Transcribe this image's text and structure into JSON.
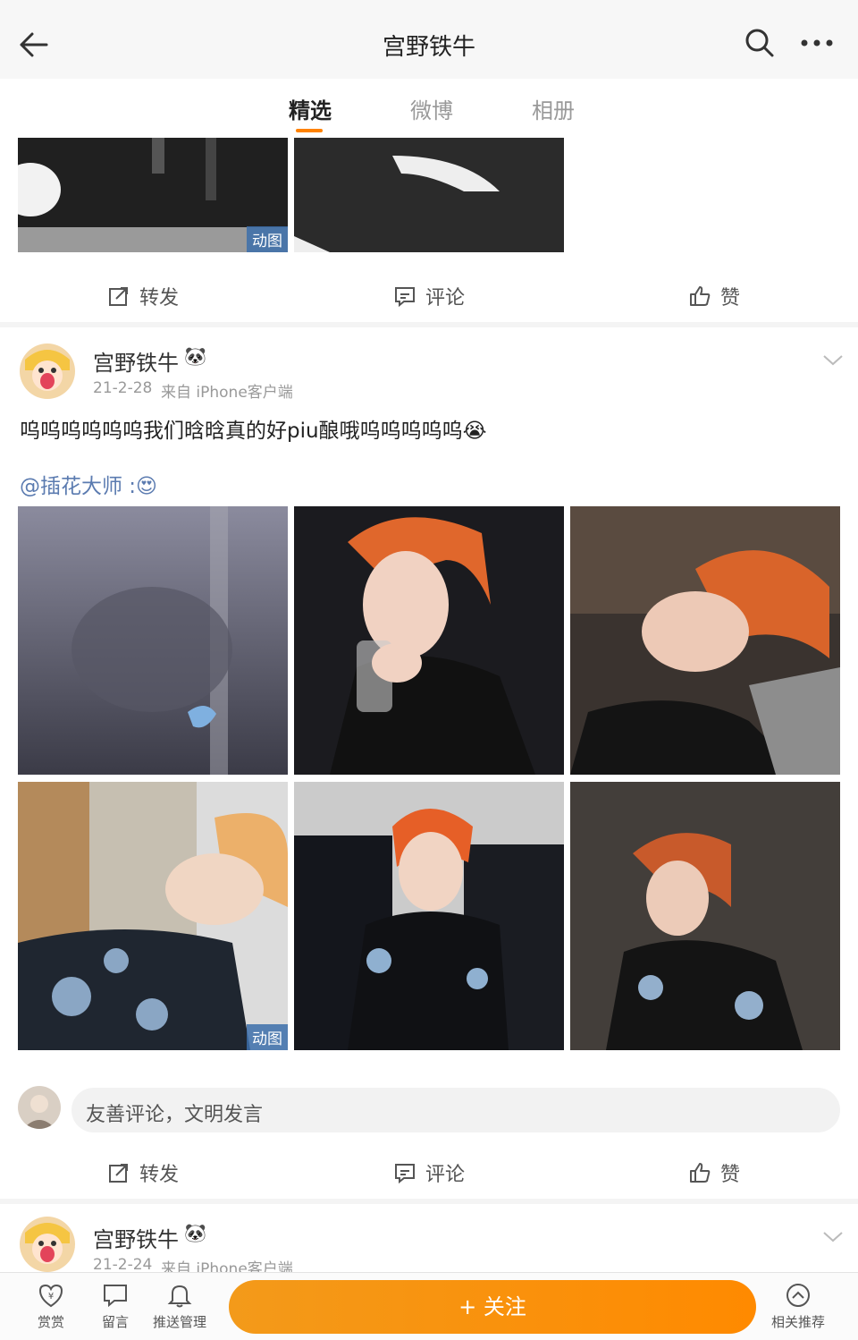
{
  "header": {
    "title": "宫野铁牛"
  },
  "tabs": [
    {
      "label": "精选",
      "active": true
    },
    {
      "label": "微博",
      "active": false
    },
    {
      "label": "相册",
      "active": false
    }
  ],
  "actions": {
    "repost": "转发",
    "comment": "评论",
    "like": "赞"
  },
  "gif_badge": "动图",
  "posts": [
    {
      "username": "宫野铁牛",
      "badge": "🐼",
      "date": "21-2-28",
      "source": "来自 iPhone客户端",
      "text": "呜呜呜呜呜呜我们晗晗真的好piu酿哦呜呜呜呜呜😭",
      "mention": "@插花大师 :😍"
    },
    {
      "username": "宫野铁牛",
      "badge": "🐼",
      "date": "21-2-24",
      "source": "来自 iPhone客户端"
    }
  ],
  "comment_placeholder": "友善评论，文明发言",
  "bottom_bar": {
    "reward": "赏赏",
    "message": "留言",
    "push": "推送管理",
    "follow": "+ 关注",
    "recommend": "相关推荐"
  },
  "colors": {
    "accent": "#ff8200",
    "link": "#5b7bb0"
  }
}
